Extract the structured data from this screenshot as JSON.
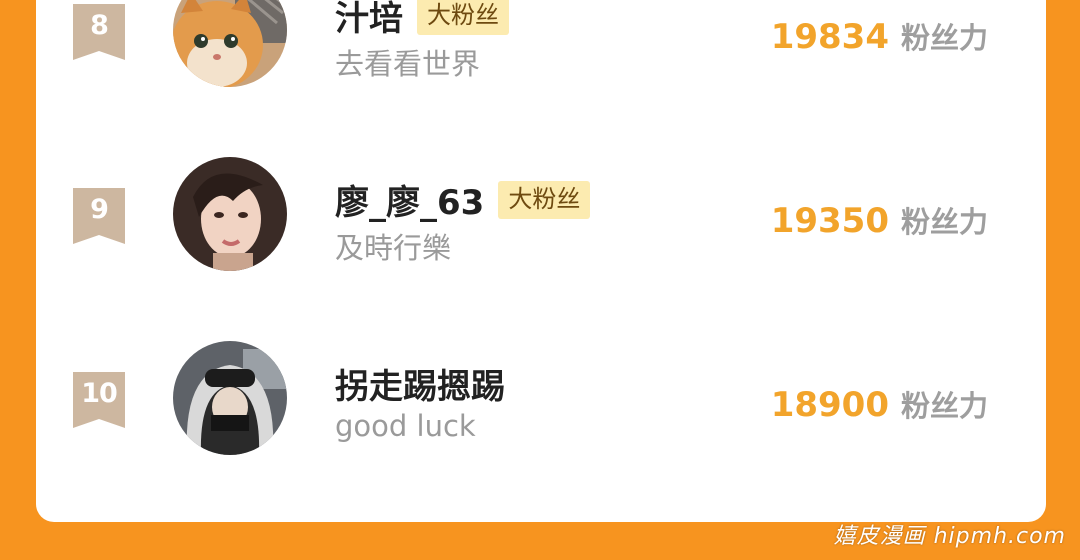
{
  "leaderboard": {
    "rows": [
      {
        "rank": "8",
        "name": "汁培",
        "badge": "大粉丝",
        "signature": "去看看世界",
        "score": "19834",
        "score_unit": "粉丝力",
        "avatar_icon": "cat-avatar"
      },
      {
        "rank": "9",
        "name": "廖_廖_63",
        "badge": "大粉丝",
        "signature": "及時行樂",
        "score": "19350",
        "score_unit": "粉丝力",
        "avatar_icon": "woman-avatar"
      },
      {
        "rank": "10",
        "name": "拐走踢摁踢",
        "badge": "",
        "signature": "good luck",
        "score": "18900",
        "score_unit": "粉丝力",
        "avatar_icon": "hooded-person-avatar"
      }
    ]
  },
  "watermark": "嬉皮漫画 hipmh.com",
  "colors": {
    "page_background": "#f7941f",
    "card_background": "#ffffff",
    "score": "#f2a42b",
    "badge_background": "#fcebb0",
    "rank_ribbon": "#cdb7a0"
  }
}
